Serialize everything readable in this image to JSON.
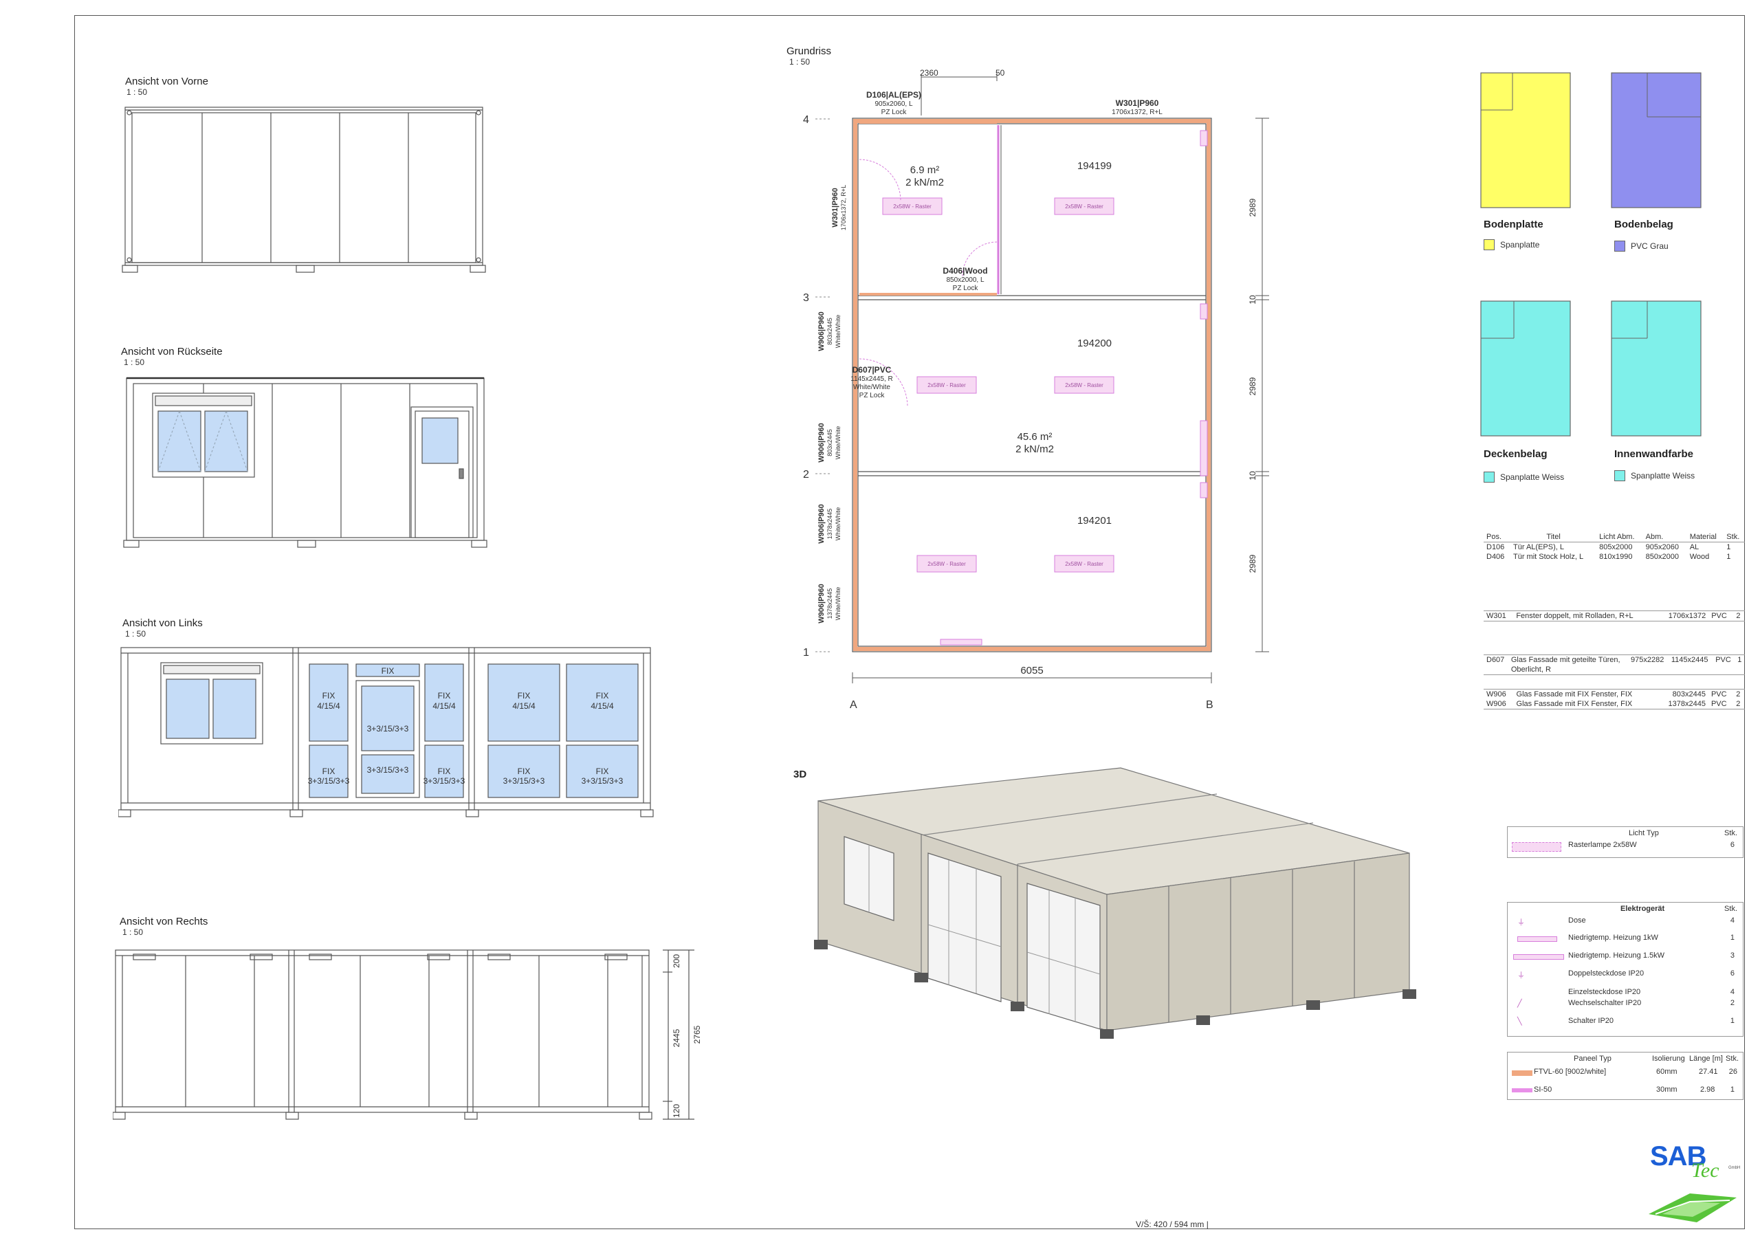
{
  "views": {
    "front": {
      "title": "Ansicht von Vorne",
      "scale": "1 : 50"
    },
    "back": {
      "title": "Ansicht von Rückseite",
      "scale": "1 : 50"
    },
    "left": {
      "title": "Ansicht von Links",
      "scale": "1 : 50"
    },
    "right": {
      "title": "Ansicht von Rechts",
      "scale": "1 : 50"
    },
    "plan": {
      "title": "Grundriss",
      "scale": "1 : 50"
    },
    "iso": {
      "title": "3D"
    }
  },
  "left_view_labels": {
    "fix": "FIX",
    "fix_glass_1": "4/15/4",
    "fix_glass_2": "3+3/15/3+3",
    "door_glass": "3+3/15/3+3"
  },
  "right_view_dims": [
    "200",
    "2445",
    "2765",
    "120"
  ],
  "plan": {
    "grid_rows": [
      "4",
      "3",
      "2",
      "1"
    ],
    "grid_cols": [
      "A",
      "B"
    ],
    "top_dims": [
      "2360",
      "50"
    ],
    "right_dims": [
      "2989",
      "10",
      "2989",
      "10",
      "2989"
    ],
    "bottom_dim": "6055",
    "door_d106": {
      "code": "D106|AL(EPS)",
      "size": "905x2060, L",
      "lock": "PZ Lock"
    },
    "window_w301_top": {
      "code": "W301|P960",
      "size": "1706x1372, R+L"
    },
    "window_w301_left": {
      "code": "W301|P960",
      "size": "1706x1372, R+L"
    },
    "door_d406": {
      "code": "D406|Wood",
      "size": "850x2000, L",
      "lock": "PZ Lock"
    },
    "door_d607": {
      "code": "D607|PVC",
      "size": "1145x2445, R",
      "color": "White/White",
      "lock": "PZ Lock"
    },
    "w906_a": {
      "code": "W906|P960",
      "size": "803x2445",
      "color": "White/White"
    },
    "w906_b": {
      "code": "W906|P960",
      "size": "803x2445",
      "color": "White/White"
    },
    "w906_c": {
      "code": "W906|P960",
      "size": "1378x2445",
      "color": "White/White"
    },
    "w906_d": {
      "code": "W906|P960",
      "size": "1378x2445",
      "color": "White/White"
    },
    "room_small": {
      "area": "6.9 m²",
      "load": "2 kN/m2"
    },
    "room_large": {
      "area": "45.6 m²",
      "load": "2 kN/m2"
    },
    "module_ids": [
      "194199",
      "194200",
      "194201"
    ],
    "lamp_label": "2x58W - Raster"
  },
  "legend": {
    "bodenplatte": {
      "title": "Bodenplatte",
      "item": "Spanplatte",
      "color": "#ffff66"
    },
    "bodenbelag": {
      "title": "Bodenbelag",
      "item": "PVC Grau",
      "color": "#8f8fef"
    },
    "deckenbelag": {
      "title": "Deckenbelag",
      "item": "Spanplatte Weiss",
      "color": "#7ff0ea"
    },
    "innenwandfarbe": {
      "title": "Innenwandfarbe",
      "item": "Spanplatte Weiss",
      "color": "#7ff0ea"
    }
  },
  "door_table": {
    "headers": [
      "Pos.",
      "Titel",
      "Licht Abm.",
      "Abm.",
      "Material",
      "Stk."
    ],
    "rows": [
      [
        "D106",
        "Tür AL(EPS), L",
        "805x2000",
        "905x2060",
        "AL",
        "1"
      ],
      [
        "D406",
        "Tür mit Stock Holz, L",
        "810x1990",
        "850x2000",
        "Wood",
        "1"
      ]
    ]
  },
  "window_table": [
    [
      "W301",
      "Fenster doppelt, mit Rolladen, R+L",
      "1706x1372",
      "PVC",
      "2"
    ]
  ],
  "facade_table": [
    [
      "D607",
      "Glas Fassade mit geteilte Türen,",
      "Oberlicht, R",
      "975x2282",
      "1145x2445",
      "PVC",
      "1"
    ]
  ],
  "w906_table": [
    [
      "W906",
      "Glas Fassade mit FIX Fenster, FIX",
      "803x2445",
      "PVC",
      "2"
    ],
    [
      "W906",
      "Glas Fassade mit FIX Fenster, FIX",
      "1378x2445",
      "PVC",
      "2"
    ]
  ],
  "light_table": {
    "headers": [
      "Licht Typ",
      "Stk."
    ],
    "rows": [
      [
        "Rasterlampe 2x58W",
        "6"
      ]
    ]
  },
  "electro_table": {
    "headers": [
      "Elektrogerät",
      "Stk."
    ],
    "rows": [
      [
        "Dose",
        "4"
      ],
      [
        "Niedrigtemp. Heizung 1kW",
        "1"
      ],
      [
        "Niedrigtemp. Heizung 1.5kW",
        "3"
      ],
      [
        "Doppelsteckdose IP20",
        "6"
      ],
      [
        "Einzelsteckdose IP20",
        "4"
      ],
      [
        "Wechselschalter IP20",
        "2"
      ],
      [
        "Schalter IP20",
        "1"
      ]
    ]
  },
  "panel_table": {
    "headers": [
      "Paneel Typ",
      "Isolierung",
      "Länge [m]",
      "Stk."
    ],
    "rows": [
      [
        "FTVL-60 [9002/white]",
        "60mm",
        "27.41",
        "26"
      ],
      [
        "SI-50",
        "30mm",
        "2.98",
        "1"
      ]
    ]
  },
  "logo": {
    "main": "SAB",
    "sub": "Tec",
    "tiny": "GmbH"
  },
  "footer": "V/Š: 420 / 594 mm |"
}
